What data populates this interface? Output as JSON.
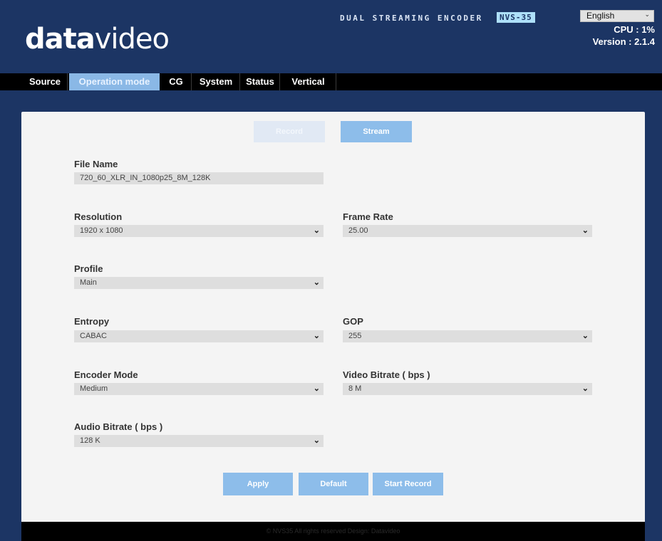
{
  "header": {
    "logo_bold": "data",
    "logo_light": "video",
    "product_title": "DUAL STREAMING ENCODER",
    "model": "NVS-35",
    "language": "English",
    "cpu": "CPU : 1%",
    "version": "Version : 2.1.4"
  },
  "nav": {
    "tabs": [
      "Source",
      "Operation mode",
      "CG",
      "System",
      "Status",
      "Vertical"
    ],
    "active": "Operation mode"
  },
  "mode": {
    "record_label": "Record",
    "stream_label": "Stream",
    "selected": "Stream"
  },
  "form": {
    "file_name": {
      "label": "File Name",
      "value": "720_60_XLR_IN_1080p25_8M_128K"
    },
    "resolution": {
      "label": "Resolution",
      "value": "1920 x 1080"
    },
    "frame_rate": {
      "label": "Frame Rate",
      "value": "25.00"
    },
    "profile": {
      "label": "Profile",
      "value": "Main"
    },
    "entropy": {
      "label": "Entropy",
      "value": "CABAC"
    },
    "gop": {
      "label": "GOP",
      "value": "255"
    },
    "encoder_mode": {
      "label": "Encoder Mode",
      "value": "Medium"
    },
    "video_bitrate": {
      "label": "Video Bitrate ( bps )",
      "value": "8 M"
    },
    "audio_bitrate": {
      "label": "Audio Bitrate ( bps )",
      "value": "128 K"
    }
  },
  "actions": {
    "apply": "Apply",
    "default": "Default",
    "start_record": "Start Record"
  },
  "footer": {
    "text": "© NVS35 All rights reserved Design: Datavideo"
  },
  "colors": {
    "background": "#1c3564",
    "nav": "#000000",
    "active_tab": "#8ab8e6",
    "button": "#8dbdea",
    "panel": "#f4f4f4"
  }
}
